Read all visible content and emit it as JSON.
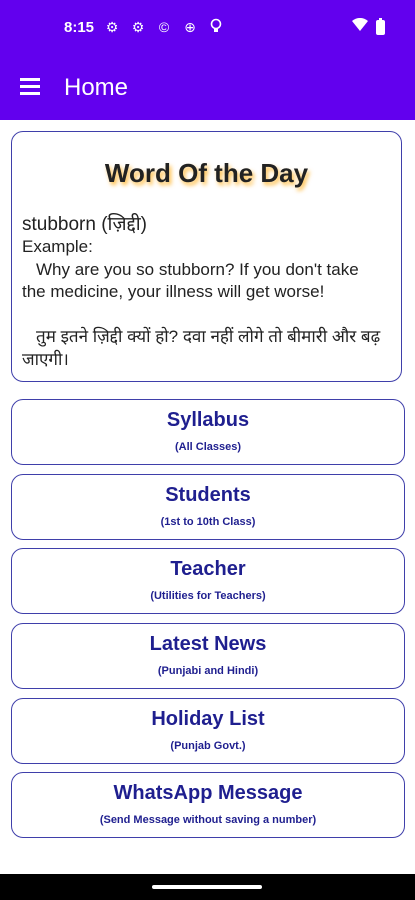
{
  "status_bar": {
    "time": "8:15",
    "icons": [
      "gear-icon",
      "gear-icon",
      "copyright-icon",
      "target-icon",
      "lightbulb-icon"
    ],
    "right_icons": [
      "wifi-icon",
      "battery-icon"
    ]
  },
  "app_bar": {
    "title": "Home"
  },
  "word_of_day": {
    "title": "Word Of the Day",
    "word": "stubborn (ज़िद्दी)",
    "example_label": "Example:",
    "example_en": "Why are you so stubborn? If you don't take the medicine, your illness will get worse!",
    "example_hi": "तुम इतने ज़िद्दी क्यों हो? दवा नहीं लोगे तो बीमारी और बढ़ जाएगी।"
  },
  "menu": [
    {
      "title": "Syllabus",
      "subtitle": "(All Classes)"
    },
    {
      "title": "Students",
      "subtitle": "(1st to 10th Class)"
    },
    {
      "title": "Teacher",
      "subtitle": "(Utilities for Teachers)"
    },
    {
      "title": "Latest News",
      "subtitle": "(Punjabi and Hindi)"
    },
    {
      "title": "Holiday List",
      "subtitle": "(Punjab Govt.)"
    },
    {
      "title": "WhatsApp Message",
      "subtitle": "(Send Message without saving a number)"
    }
  ],
  "colors": {
    "primary": "#6200ee",
    "card_border": "#3f3faa",
    "card_text": "#1f1f8f"
  }
}
